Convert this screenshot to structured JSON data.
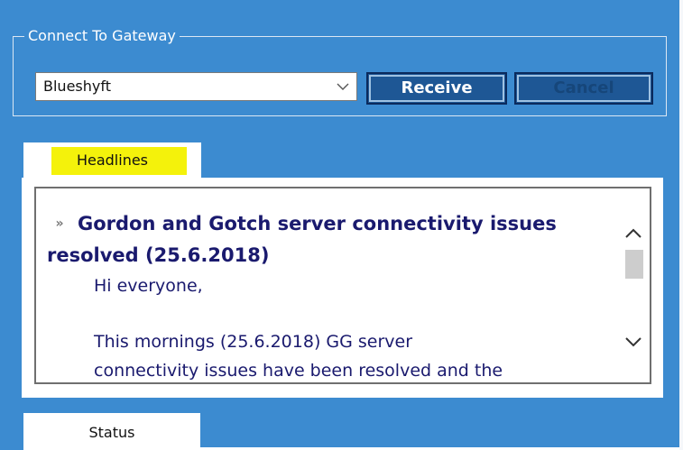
{
  "gateway": {
    "legend": "Connect To Gateway",
    "selected": "Blueshyft",
    "receive_label": "Receive",
    "cancel_label": "Cancel"
  },
  "tabs": {
    "headlines": "Headlines",
    "status": "Status"
  },
  "article": {
    "bullet": "»",
    "title": "Gordon and Gotch server connectivity issues resolved (25.6.2018)",
    "greeting": "Hi everyone,",
    "body_line1": "This mornings (25.6.2018) GG server",
    "body_line2": "connectivity issues have been resolved and the"
  },
  "colors": {
    "background": "#3c8bd0",
    "highlight": "#f4f20b",
    "title_text": "#1a1a6e",
    "button": "#1e5795"
  },
  "icons": {
    "combo_arrow": "chevron-down-icon",
    "scroll_up": "chevron-up-icon",
    "scroll_down": "chevron-down-icon"
  }
}
